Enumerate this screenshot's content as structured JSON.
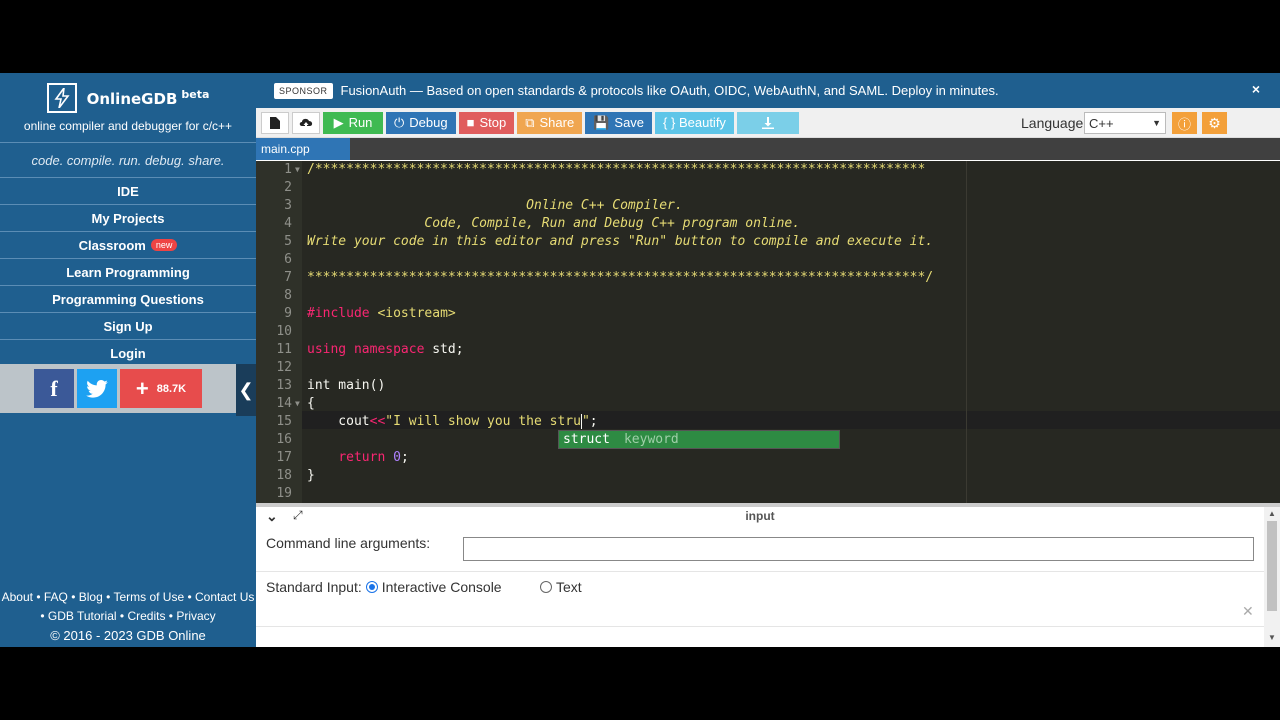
{
  "brand": {
    "name": "OnlineGDB",
    "beta": "beta",
    "subtitle": "online compiler and debugger for c/c++",
    "tagline": "code. compile. run. debug. share."
  },
  "nav": [
    {
      "label": "IDE"
    },
    {
      "label": "My Projects"
    },
    {
      "label": "Classroom",
      "badge": "new"
    },
    {
      "label": "Learn Programming"
    },
    {
      "label": "Programming Questions"
    },
    {
      "label": "Sign Up"
    },
    {
      "label": "Login"
    }
  ],
  "social": {
    "facebook": "f",
    "share_count": "88.7K"
  },
  "footer": {
    "links1": [
      "About",
      "FAQ",
      "Blog",
      "Terms of Use",
      "Contact Us"
    ],
    "links2": [
      "GDB Tutorial",
      "Credits",
      "Privacy"
    ],
    "copyright": "© 2016 - 2023 GDB Online"
  },
  "sponsor": {
    "tag": "SPONSOR",
    "text": "FusionAuth — Based on open standards & protocols like OAuth, OIDC, WebAuthN, and SAML. Deploy in minutes.",
    "close": "×"
  },
  "toolbar": {
    "run": "Run",
    "debug": "Debug",
    "stop": "Stop",
    "share": "Share",
    "save": "Save",
    "beautify": "{ } Beautify",
    "language_label": "Language",
    "language_value": "C++"
  },
  "tab": {
    "filename": "main.cpp"
  },
  "editor": {
    "line_numbers": [
      "1",
      "2",
      "3",
      "4",
      "5",
      "6",
      "7",
      "8",
      "9",
      "10",
      "11",
      "12",
      "13",
      "14",
      "15",
      "16",
      "17",
      "18",
      "19"
    ],
    "lines": [
      "/******************************************************************************",
      "",
      "                            Online C++ Compiler.",
      "               Code, Compile, Run and Debug C++ program online.",
      "Write your code in this editor and press \"Run\" button to compile and execute it.",
      "",
      "*******************************************************************************/",
      "",
      "#include <iostream>",
      "",
      "using namespace std;",
      "",
      "int main()",
      "{",
      "    cout<<\"I will show you the stru\";",
      "",
      "    return 0;",
      "}",
      ""
    ],
    "autocomplete": {
      "word": "struct",
      "meta": "keyword"
    }
  },
  "io": {
    "title": "input",
    "cmd_label": "Command line arguments:",
    "cmd_value": "",
    "stdin_label": "Standard Input:",
    "option_interactive": "Interactive Console",
    "option_text": "Text",
    "selected": "Interactive Console"
  },
  "colors": {
    "sidebar": "#1f5f8f",
    "editor_bg": "#272822",
    "run": "#3fba52",
    "stop": "#e05d5d",
    "accent_orange": "#f3a03a"
  }
}
